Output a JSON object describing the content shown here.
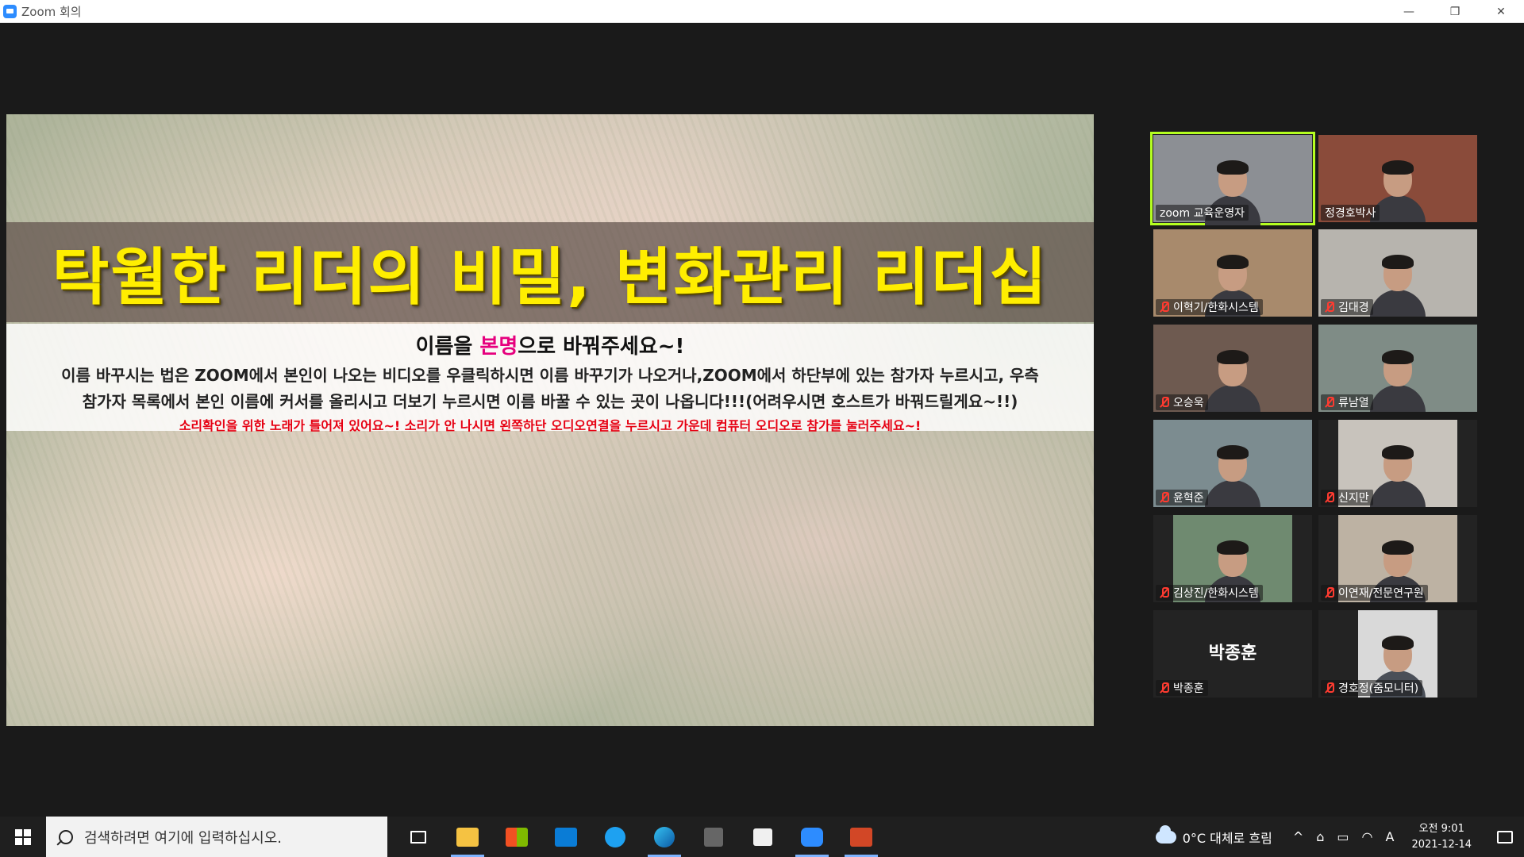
{
  "window": {
    "title": "Zoom 회의",
    "minimize_glyph": "—",
    "restore_glyph": "❐",
    "close_glyph": "✕"
  },
  "slide": {
    "title": "탁월한 리더의 비밀, 변화관리 리더십",
    "notice_head_pre": "이름을 ",
    "notice_head_hl": "본명",
    "notice_head_post": "으로 바꿔주세요~!",
    "notice_line1": "이름 바꾸시는 법은 ZOOM에서 본인이 나오는 비디오를 우클릭하시면 이름 바꾸기가 나오거나,ZOOM에서 하단부에 있는 참가자 누르시고, 우측",
    "notice_line2": "참가자 목록에서 본인 이름에 커서를 올리시고 더보기 누르시면 이름 바꿀 수 있는 곳이 나옵니다!!!(어려우시면 호스트가 바꿔드릴게요~!!)",
    "notice_red": "소리확인을 위한 노래가 틀어져 있어요~! 소리가 안 나시면 왼쪽하단 오디오연결을 누르시고 가운데 컴퓨터 오디오로 참가를 눌러주세요~!"
  },
  "participants": [
    {
      "name": "zoom 교육운영자",
      "muted": false,
      "active": true,
      "bg": "#8c8f94"
    },
    {
      "name": "정경호박사",
      "muted": false,
      "active": false,
      "bg": "#8a4b3a"
    },
    {
      "name": "이혁기/한화시스템",
      "muted": true,
      "active": false,
      "bg": "#a88a6c"
    },
    {
      "name": "김대경",
      "muted": true,
      "active": false,
      "bg": "#b7b4ae"
    },
    {
      "name": "오승욱",
      "muted": true,
      "active": false,
      "bg": "#6e5a50"
    },
    {
      "name": "류남열",
      "muted": true,
      "active": false,
      "bg": "#7f8c86"
    },
    {
      "name": "윤혁준",
      "muted": true,
      "active": false,
      "bg": "#7c8c90"
    },
    {
      "name": "신지만",
      "muted": true,
      "active": false,
      "bg": "#c8c3bc"
    },
    {
      "name": "김상진/한화시스템",
      "muted": true,
      "active": false,
      "bg": "#6f8a70"
    },
    {
      "name": "이연재/전문연구원",
      "muted": true,
      "active": false,
      "bg": "#bdb2a3"
    },
    {
      "name": "박종훈",
      "muted": true,
      "active": false,
      "bg": "",
      "no_video": true,
      "display": "박종훈"
    },
    {
      "name": "경호정(줌모니터)",
      "muted": true,
      "active": false,
      "bg": "#d9d9d9"
    }
  ],
  "taskbar": {
    "search_placeholder": "검색하려면 여기에 입력하십시오.",
    "weather": "0°C  대체로 흐림",
    "time": "오전 9:01",
    "date": "2021-12-14",
    "ime": "A",
    "chevron": "^"
  }
}
